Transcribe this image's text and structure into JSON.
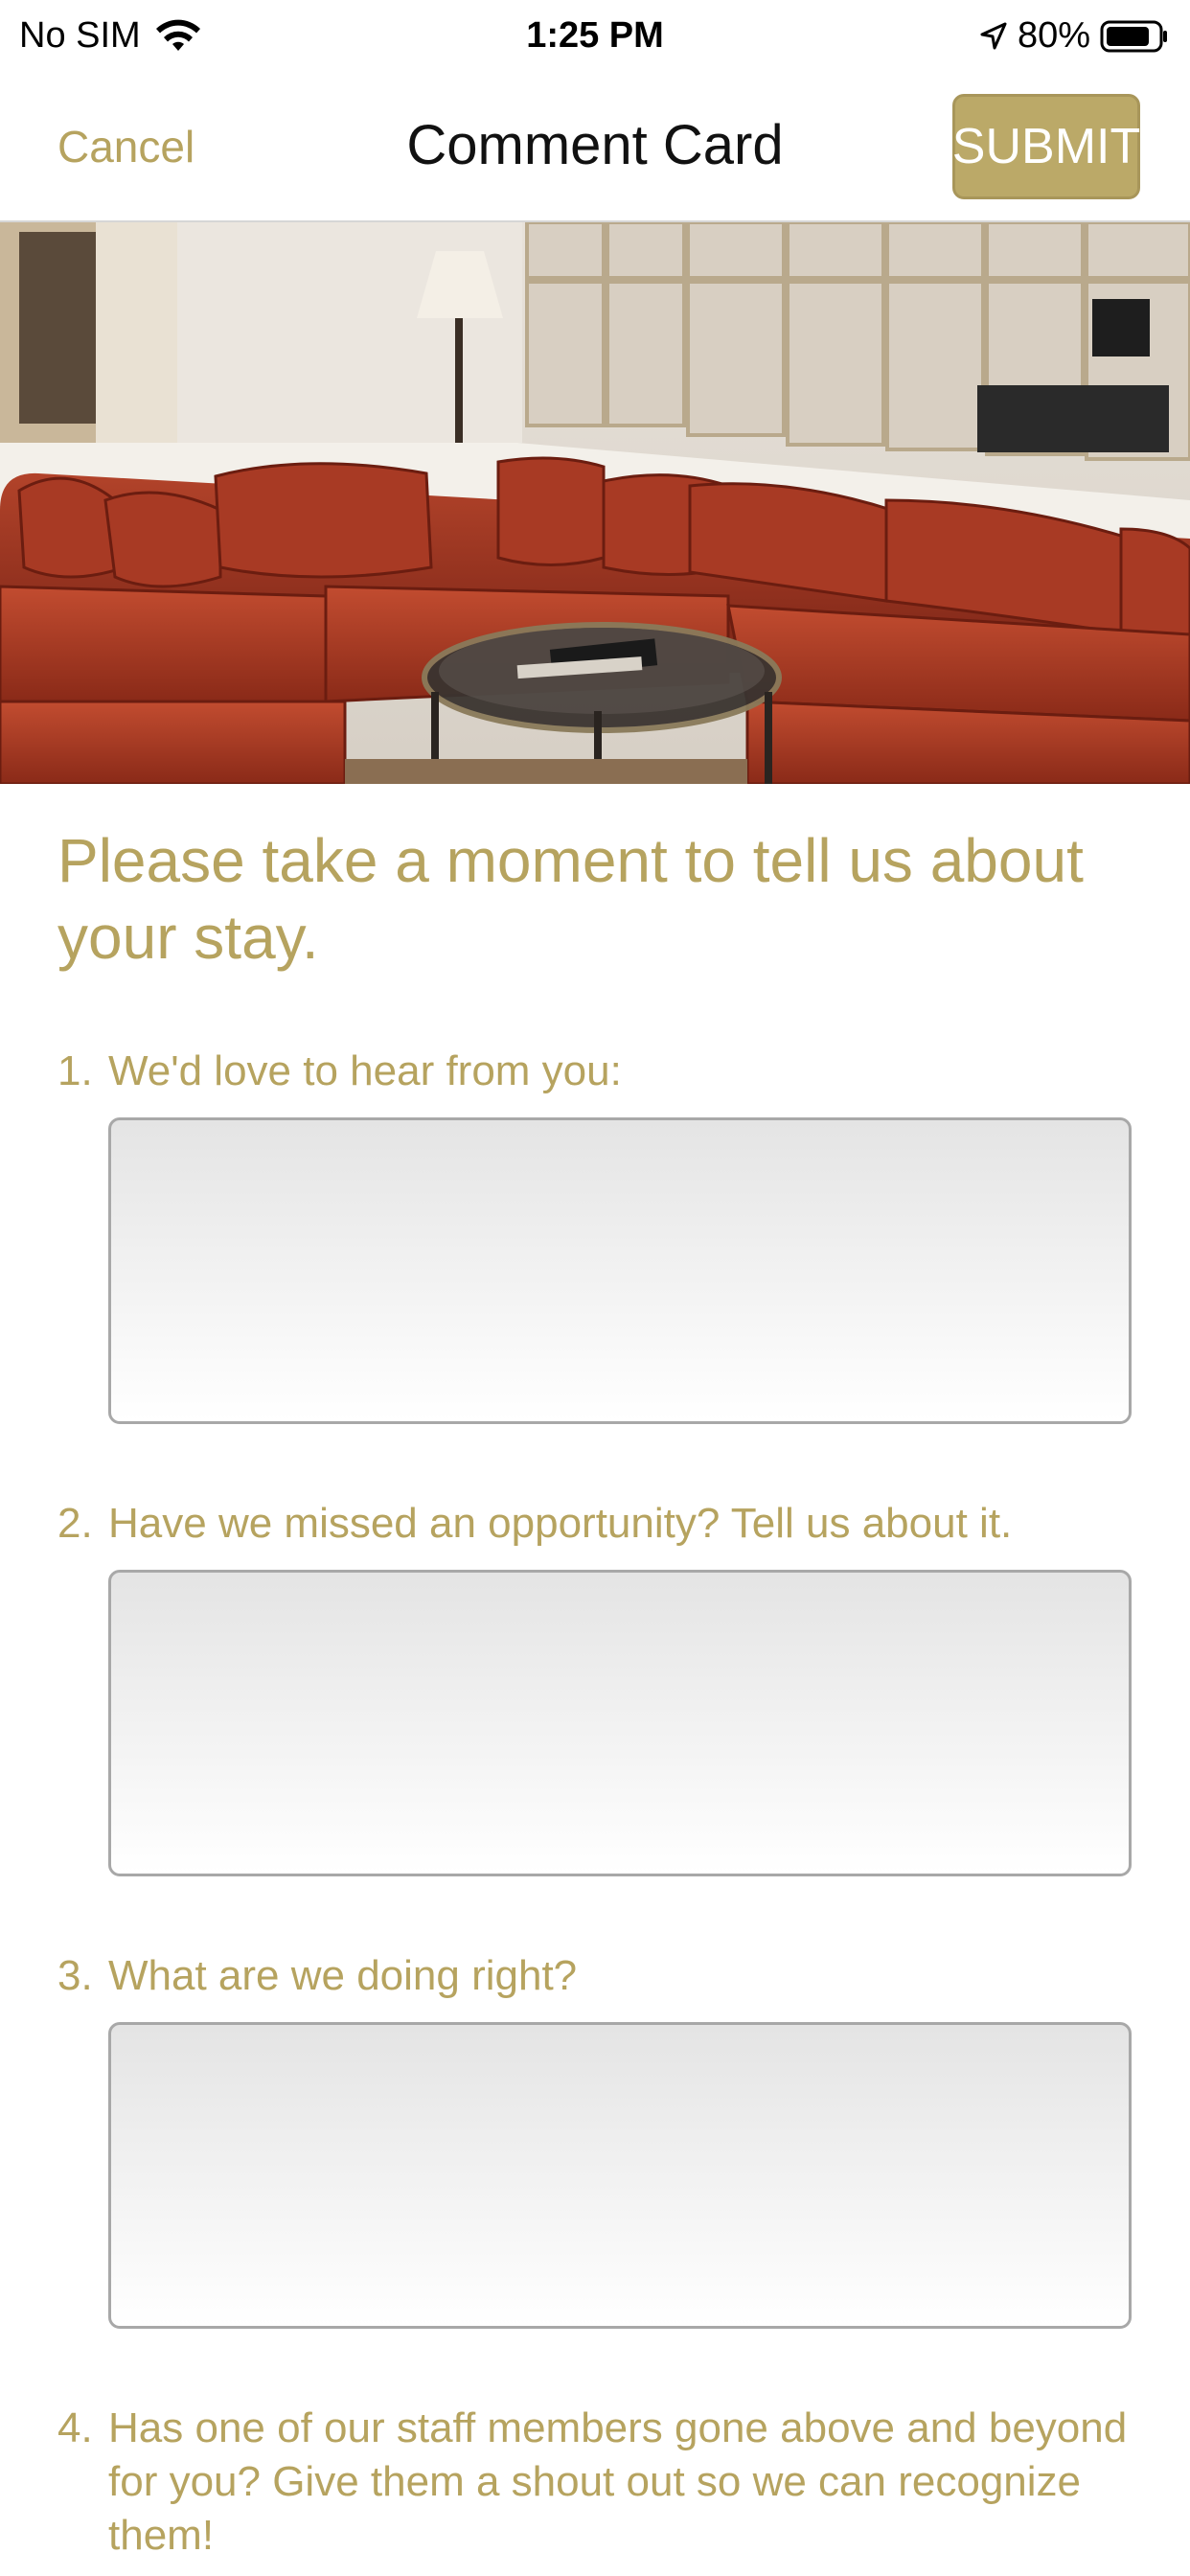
{
  "status_bar": {
    "carrier": "No SIM",
    "time": "1:25 PM",
    "battery_percent": "80%"
  },
  "nav": {
    "cancel_label": "Cancel",
    "title": "Comment Card",
    "submit_label": "SUBMIT"
  },
  "intro_text": "Please take a moment to tell us about your stay.",
  "questions": [
    {
      "number": "1.",
      "text": "We'd love to hear from you:"
    },
    {
      "number": "2.",
      "text": "Have we missed an opportunity? Tell us about it."
    },
    {
      "number": "3.",
      "text": "What are we doing right?"
    },
    {
      "number": "4.",
      "text": "Has one of our staff members gone above and beyond for you? Give them a shout out so we can recognize them!"
    }
  ],
  "colors": {
    "accent": "#b6a35f",
    "submit_bg": "#bba968",
    "input_border": "#a8a8a8"
  },
  "icons": [
    "wifi-icon",
    "location-arrow-icon",
    "battery-icon"
  ]
}
